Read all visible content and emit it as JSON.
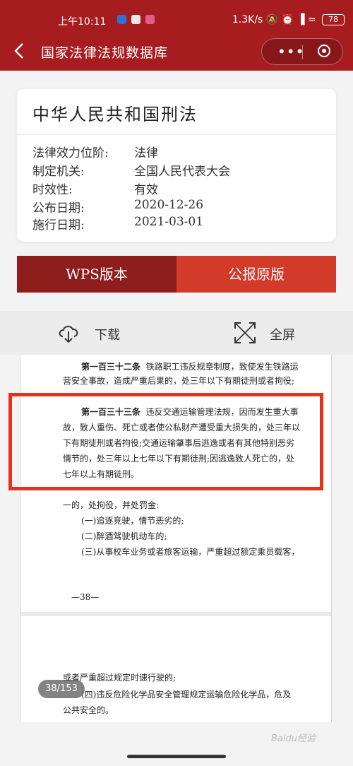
{
  "status_bar": {
    "time": "上午10:11",
    "speed": "1.3K/s",
    "battery": "78"
  },
  "navbar": {
    "title": "国家法律法规数据库",
    "more_label": "•••"
  },
  "law": {
    "title": "中华人民共和国刑法",
    "fields": [
      {
        "label": "法律效力位阶:",
        "value": "法律"
      },
      {
        "label": "制定机关:",
        "value": "全国人民代表大会"
      },
      {
        "label": "时效性:",
        "value": "有效"
      },
      {
        "label": "公布日期:",
        "value": "2020-12-26"
      },
      {
        "label": "施行日期:",
        "value": "2021-03-01"
      }
    ]
  },
  "tabs": {
    "wps": "WPS版本",
    "original": "公报原版"
  },
  "toolbar": {
    "download": "下载",
    "fullscreen": "全屏"
  },
  "document": {
    "lines": [
      {
        "bold": "第一百三十二条",
        "text": "铁路职工违反规章制度，致使发生铁路运"
      },
      {
        "bold": "",
        "text": "营安全事故，造成严重后果的，处三年以下有期徒刑或者拘役;"
      },
      {
        "bold": "第一百三十三条",
        "text": "违反交通运输管理法规，因而发生重大事"
      },
      {
        "bold": "",
        "text": "故，致人重伤、死亡或者使公私财产遭受重大损失的，处三年以"
      },
      {
        "bold": "",
        "text": "下有期徒刑或者拘役;交通运输肇事后逃逸或者有其他特别恶劣"
      },
      {
        "bold": "",
        "text": "情节的，处三年以上七年以下有期徒刑;因逃逸致人死亡的，处"
      },
      {
        "bold": "",
        "text": "七年以上有期徒刑。"
      },
      {
        "bold": "",
        "text": "一的，处拘役，并处罚金:"
      },
      {
        "bold": "",
        "text": "(一)追逐竞驶，情节恶劣的;"
      },
      {
        "bold": "",
        "text": "(二)醉酒驾驶机动车的;"
      },
      {
        "bold": "",
        "text": "(三)从事校车业务或者旅客运输，严重超过额定乘员载客，"
      },
      {
        "bold": "",
        "text": "—38—"
      },
      {
        "bold": "",
        "text": "或者严重超过规定时速行驶的;"
      },
      {
        "bold": "",
        "text": "(四)违反危险化学品安全管理规定运输危险化学品，危及"
      },
      {
        "bold": "",
        "text": "公共安全的。"
      }
    ],
    "page_indicator": "38/153"
  },
  "watermark": "Baidu经验",
  "colors": {
    "brand": "#a71d1f",
    "tab_dark": "#8e1e1c",
    "tab_light": "#d23a2a",
    "highlight": "#e5321d"
  }
}
